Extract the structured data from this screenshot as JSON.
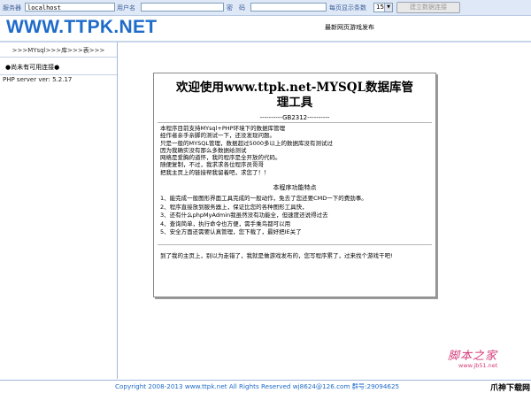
{
  "topbar": {
    "server_label": "服务器",
    "server_value": "localhost",
    "user_label": "用户名",
    "user_value": "",
    "password_label": "密　码",
    "password_value": "",
    "per_page_label": "每页显示条数",
    "per_page_value": "15",
    "connect_button": "建立数据连接"
  },
  "header": {
    "logo": "WWW.TTPK.NET",
    "link": "最新网页游戏发布"
  },
  "sidebar": {
    "title": ">>>MYsql>>>库>>>表>>>",
    "notice": "●尚未有可用连接●",
    "server_version": "PHP server ver: 5.2.17"
  },
  "panel": {
    "title_line1": "欢迎使用www.ttpk.net-MYSQL数据库管",
    "title_line2": "理工具",
    "charset": "----------GB2312----------",
    "intro": [
      "本程序目前支持MYsql+PHP环境下的数据库管理",
      "经作者亲手亲脚的测试一下，还没发现问题。",
      "只是一般的MYSQL管理，数据超过5000多以上的数据库没有测试过",
      "因为我确实没有那么多数据给测试",
      "网络是爱胸的道怀，我的程序是全开放的代码。",
      "随便复制，不过，我求求各位程序员哥哥",
      "把我主页上的链接帮我留着吧，求您了！！"
    ],
    "features_title": "本程序功能特点",
    "features": [
      "1、能完成一般图形界面工具完成的一般动作，免去了您还要CMD一下的费劲事。",
      "2、程序直接放到服务器上，保证比您的各种图形工具快，",
      "3、还有什么phpMyAdmin我虽然没有功能全，但速度还说得过去",
      "4、查询简单，执行命令也方便，需手乘鸟都可以用",
      "5、安全方面还需要认真管理，您下载了，最好把IE关了"
    ],
    "promo": "到了我的主页上，别以为走错了，我就是做游戏发布的，您写程序累了，过来找个游戏干吧!"
  },
  "watermark": {
    "site_cn": "脚本之家",
    "site_url": "www.jb51.net",
    "corner": "爪神下载网"
  },
  "footer": {
    "copyright": "Copyright 2008-2013 www.ttpk.net All Rights Reserved wj8624@126.com 群号:29094625"
  }
}
